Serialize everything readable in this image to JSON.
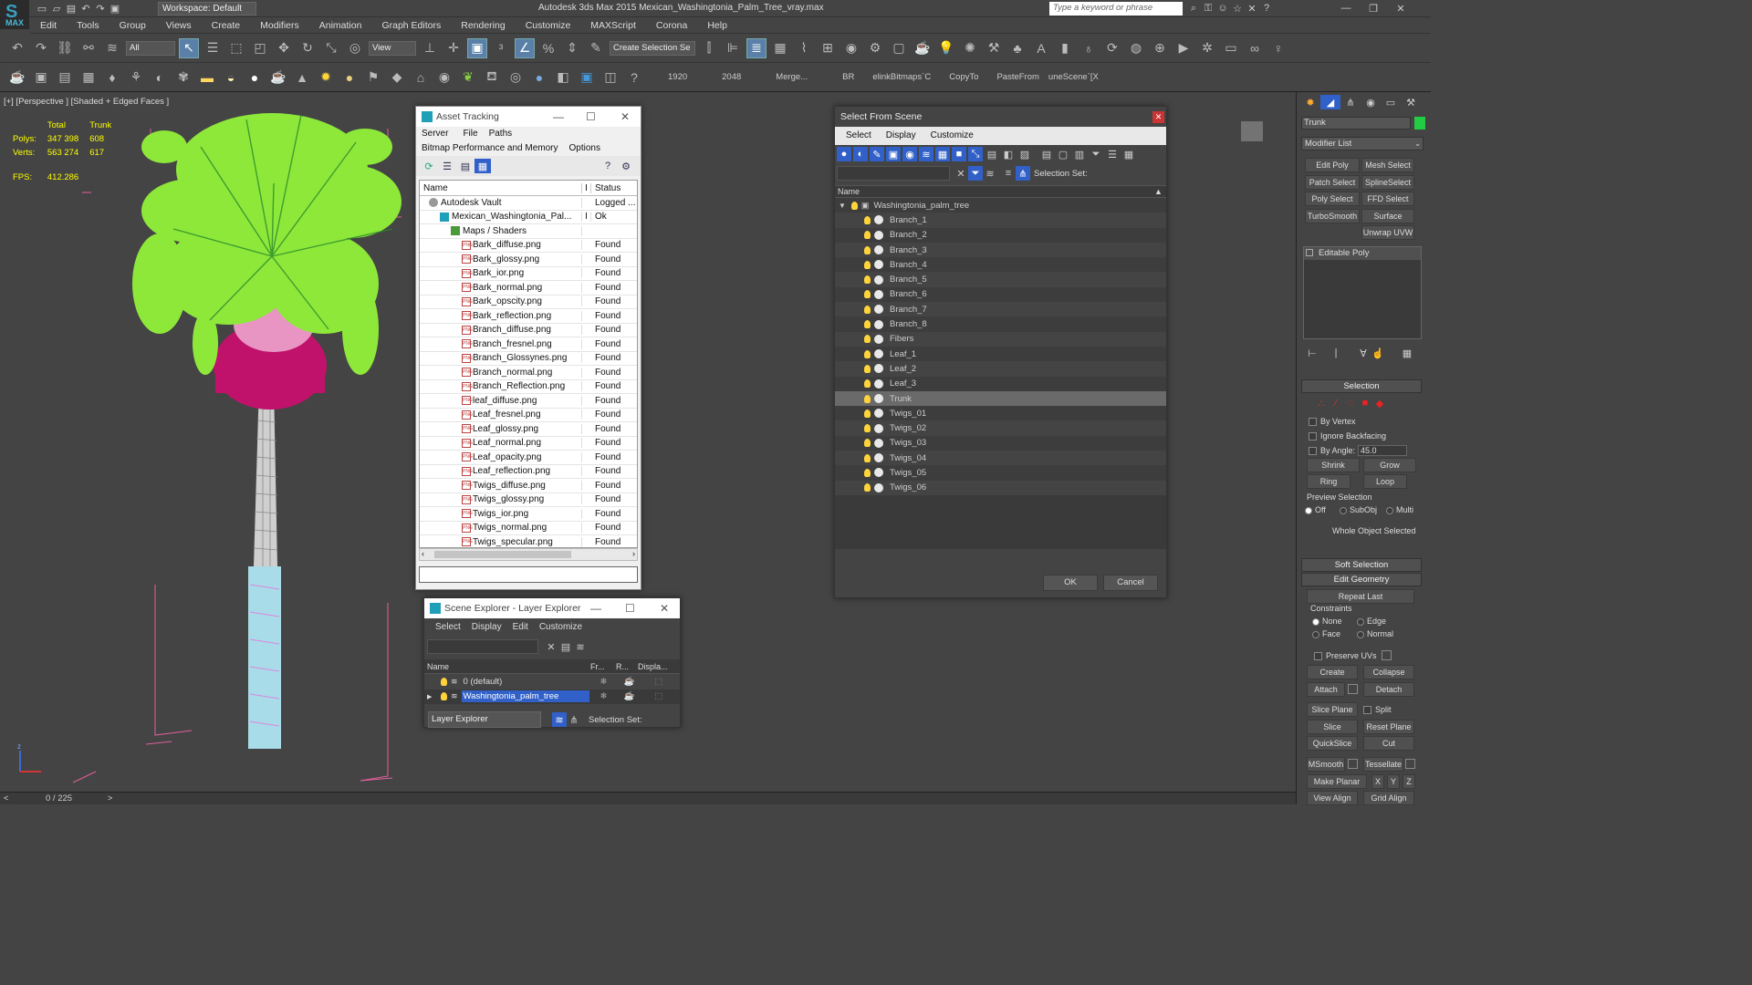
{
  "app": {
    "title": "Autodesk 3ds Max 2015     Mexican_Washingtonia_Palm_Tree_vray.max",
    "logo": "MAX",
    "workspace": "Workspace: Default",
    "search_placeholder": "Type a keyword or phrase"
  },
  "menu": [
    "Edit",
    "Tools",
    "Group",
    "Views",
    "Create",
    "Modifiers",
    "Animation",
    "Graph Editors",
    "Rendering",
    "Customize",
    "MAXScript",
    "Corona",
    "Help"
  ],
  "toolbar": {
    "filter": "All",
    "refcoord": "View",
    "selset": "Create Selection Se"
  },
  "toolbar2": {
    "labels": [
      "1920",
      "2048",
      "Merge...",
      "BR",
      "elinkBitmaps`C",
      "CopyTo",
      "PasteFrom",
      "uneScene`[X"
    ]
  },
  "viewport": {
    "label": "[+] [Perspective ] [Shaded + Edged Faces ]",
    "stats": {
      "h1": "Total",
      "h2": "Trunk",
      "polys_label": "Polys:",
      "polys_total": "347 398",
      "polys_sel": "608",
      "verts_label": "Verts:",
      "verts_total": "563 274",
      "verts_sel": "617",
      "fps_label": "FPS:",
      "fps": "412.286"
    },
    "axis": "z"
  },
  "timeline": {
    "frame": "0 / 225"
  },
  "asset_tracking": {
    "title": "Asset Tracking",
    "menu": [
      "Server",
      "File",
      "Paths"
    ],
    "menu2": [
      "Bitmap Performance and Memory",
      "Options"
    ],
    "col_name": "Name",
    "col_i": "I",
    "col_status": "Status",
    "rows": [
      {
        "name": "Autodesk Vault",
        "status": "Logged ...",
        "indent": 0,
        "kind": "vault"
      },
      {
        "name": "Mexican_Washingtonia_Pal...",
        "status": "Ok",
        "indent": 1,
        "kind": "max",
        "i": "I"
      },
      {
        "name": "Maps / Shaders",
        "status": "",
        "indent": 2,
        "kind": "folder"
      },
      {
        "name": "Bark_diffuse.png",
        "status": "Found",
        "indent": 3,
        "kind": "png"
      },
      {
        "name": "Bark_glossy.png",
        "status": "Found",
        "indent": 3,
        "kind": "png"
      },
      {
        "name": "Bark_ior.png",
        "status": "Found",
        "indent": 3,
        "kind": "png"
      },
      {
        "name": "Bark_normal.png",
        "status": "Found",
        "indent": 3,
        "kind": "png"
      },
      {
        "name": "Bark_opscity.png",
        "status": "Found",
        "indent": 3,
        "kind": "png"
      },
      {
        "name": "Bark_reflection.png",
        "status": "Found",
        "indent": 3,
        "kind": "png"
      },
      {
        "name": "Branch_diffuse.png",
        "status": "Found",
        "indent": 3,
        "kind": "png"
      },
      {
        "name": "Branch_fresnel.png",
        "status": "Found",
        "indent": 3,
        "kind": "png"
      },
      {
        "name": "Branch_Glossynes.png",
        "status": "Found",
        "indent": 3,
        "kind": "png"
      },
      {
        "name": "Branch_normal.png",
        "status": "Found",
        "indent": 3,
        "kind": "png"
      },
      {
        "name": "Branch_Reflection.png",
        "status": "Found",
        "indent": 3,
        "kind": "png"
      },
      {
        "name": "leaf_diffuse.png",
        "status": "Found",
        "indent": 3,
        "kind": "png"
      },
      {
        "name": "Leaf_fresnel.png",
        "status": "Found",
        "indent": 3,
        "kind": "png"
      },
      {
        "name": "Leaf_glossy.png",
        "status": "Found",
        "indent": 3,
        "kind": "png"
      },
      {
        "name": "Leaf_normal.png",
        "status": "Found",
        "indent": 3,
        "kind": "png"
      },
      {
        "name": "Leaf_opacity.png",
        "status": "Found",
        "indent": 3,
        "kind": "png"
      },
      {
        "name": "Leaf_reflection.png",
        "status": "Found",
        "indent": 3,
        "kind": "png"
      },
      {
        "name": "Twigs_diffuse.png",
        "status": "Found",
        "indent": 3,
        "kind": "png"
      },
      {
        "name": "Twigs_glossy.png",
        "status": "Found",
        "indent": 3,
        "kind": "png"
      },
      {
        "name": "Twigs_ior.png",
        "status": "Found",
        "indent": 3,
        "kind": "png"
      },
      {
        "name": "Twigs_normal.png",
        "status": "Found",
        "indent": 3,
        "kind": "png"
      },
      {
        "name": "Twigs_specular.png",
        "status": "Found",
        "indent": 3,
        "kind": "png"
      }
    ]
  },
  "scene_explorer": {
    "title": "Scene Explorer - Layer Explorer",
    "menu": [
      "Select",
      "Display",
      "Edit",
      "Customize"
    ],
    "col_name": "Name",
    "col_fr": "Fr...",
    "col_r": "R...",
    "col_disp": "Displa...",
    "rows": [
      {
        "name": "0 (default)",
        "selected": false
      },
      {
        "name": "Washingtonia_palm_tree",
        "selected": true
      }
    ],
    "explorer": "Layer Explorer",
    "selset": "Selection Set:"
  },
  "select_from_scene": {
    "title": "Select From Scene",
    "menu": [
      "Select",
      "Display",
      "Customize"
    ],
    "selset": "Selection Set:",
    "col_name": "Name",
    "root": "Washingtonia_palm_tree",
    "items": [
      "Branch_1",
      "Branch_2",
      "Branch_3",
      "Branch_4",
      "Branch_5",
      "Branch_6",
      "Branch_7",
      "Branch_8",
      "Fibers",
      "Leaf_1",
      "Leaf_2",
      "Leaf_3",
      "Trunk",
      "Twigs_01",
      "Twigs_02",
      "Twigs_03",
      "Twigs_04",
      "Twigs_05",
      "Twigs_06"
    ],
    "selected": "Trunk",
    "ok": "OK",
    "cancel": "Cancel"
  },
  "command_panel": {
    "object_name": "Trunk",
    "object_color": "#22cc44",
    "modifier_list": "Modifier List",
    "mod_buttons": [
      "Edit Poly",
      "Mesh Select",
      "Patch Select",
      "SplineSelect",
      "Poly Select",
      "FFD Select",
      "TurboSmooth",
      "Surface Select",
      "Unwrap UVW"
    ],
    "stack_item": "Editable Poly",
    "selection": {
      "title": "Selection",
      "by_vertex": "By Vertex",
      "ignore_backfacing": "Ignore Backfacing",
      "by_angle": "By Angle:",
      "angle": "45.0",
      "shrink": "Shrink",
      "grow": "Grow",
      "ring": "Ring",
      "loop": "Loop",
      "preview": "Preview Selection",
      "off": "Off",
      "subobj": "SubObj",
      "multi": "Multi",
      "status": "Whole Object Selected"
    },
    "soft_selection": "Soft Selection",
    "edit_geometry": {
      "title": "Edit Geometry",
      "repeat_last": "Repeat Last",
      "constraints": "Constraints",
      "none": "None",
      "edge": "Edge",
      "face": "Face",
      "normal": "Normal",
      "preserve_uvs": "Preserve UVs",
      "create": "Create",
      "collapse": "Collapse",
      "attach": "Attach",
      "detach": "Detach",
      "slice_plane": "Slice Plane",
      "split": "Split",
      "slice": "Slice",
      "reset_plane": "Reset Plane",
      "quickslice": "QuickSlice",
      "cut": "Cut",
      "msmooth": "MSmooth",
      "tessellate": "Tessellate",
      "make_planar": "Make Planar",
      "x": "X",
      "y": "Y",
      "z": "Z",
      "view_align": "View Align",
      "grid_align": "Grid Align"
    }
  },
  "colors": {
    "foliage": "#8ee83a",
    "fibers": "#c0126a",
    "trunk": "#c8c8c8",
    "trunk_base": "#a8dce8",
    "gizmo": "#e0609a",
    "accent_blue": "#3060c8"
  }
}
